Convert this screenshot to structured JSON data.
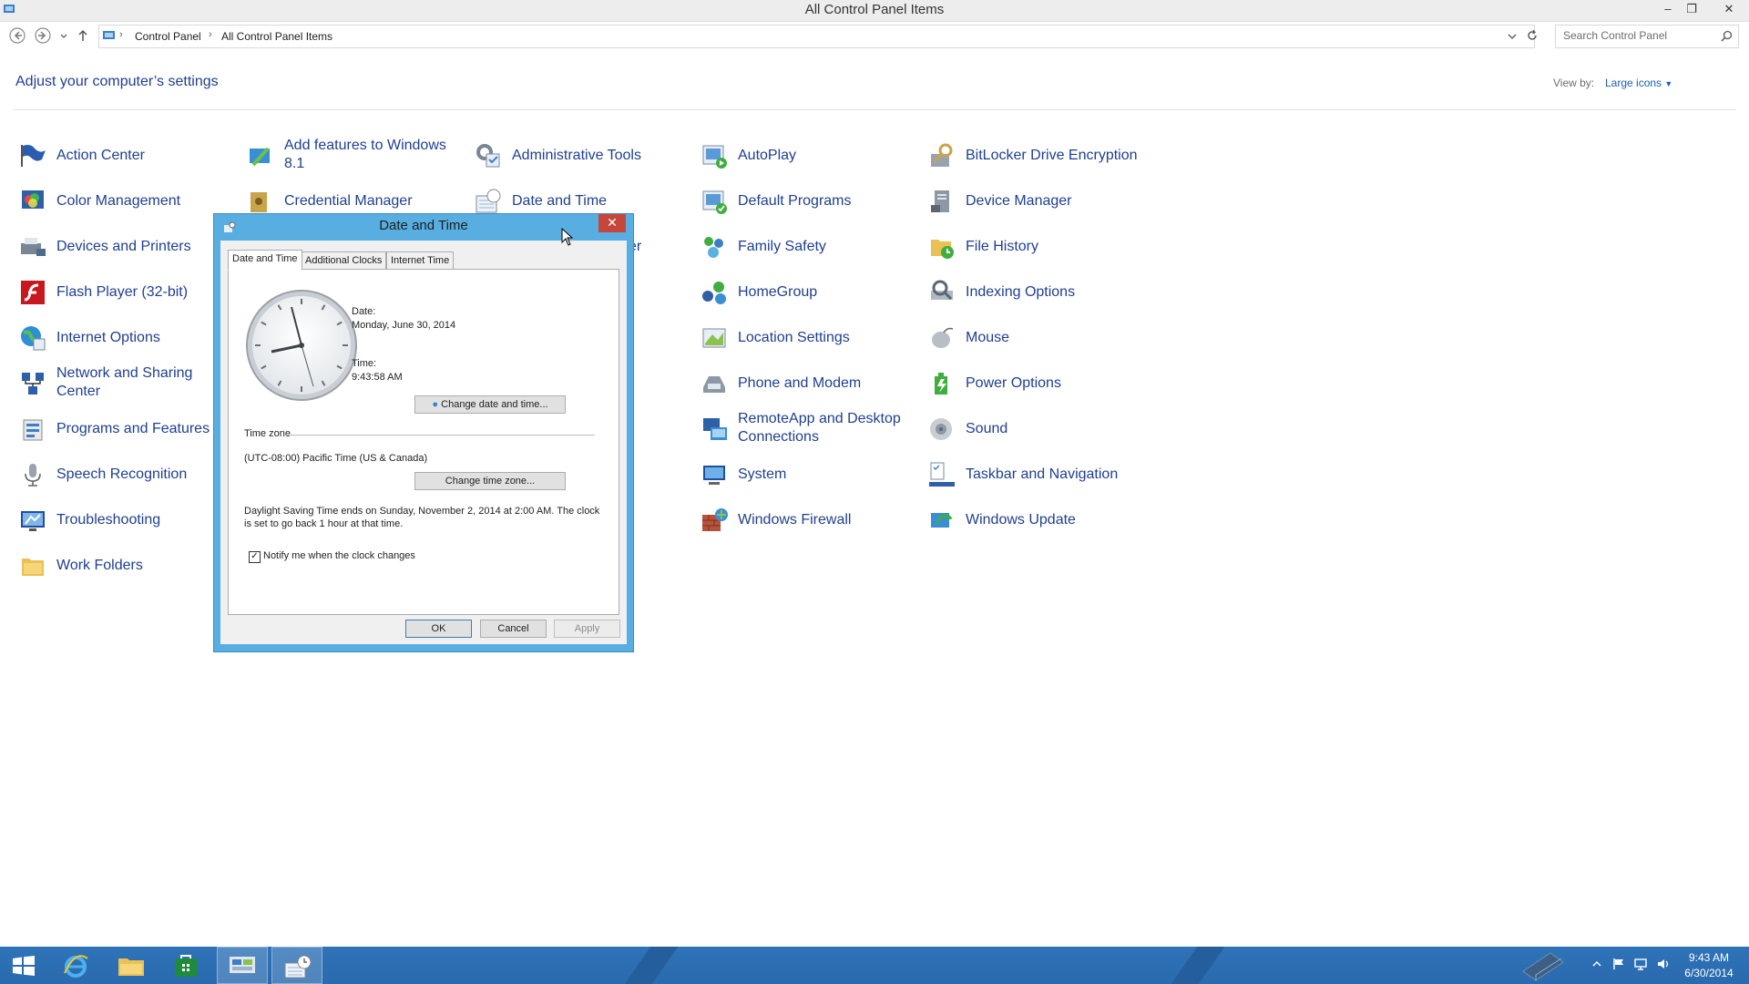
{
  "window": {
    "title": "All Control Panel Items",
    "minimize": "–",
    "restore": "❐",
    "close": "✕"
  },
  "address": {
    "crumbs": [
      "Control Panel",
      "All Control Panel Items"
    ],
    "search_placeholder": "Search Control Panel"
  },
  "header": {
    "title": "Adjust your computer’s settings",
    "view_by_label": "View by:",
    "view_by_value": "Large icons"
  },
  "items": {
    "col1": [
      "Action Center",
      "Color Management",
      "Devices and Printers",
      "Flash Player (32-bit)",
      "Internet Options",
      "Network and Sharing Center",
      "Programs and Features",
      "Speech Recognition",
      "Troubleshooting",
      "Work Folders"
    ],
    "col2": [
      "Add features to Windows 8.1",
      "Credential Manager"
    ],
    "col3": [
      "Administrative Tools",
      "Date and Time",
      "er"
    ],
    "col4": [
      "AutoPlay",
      "Default Programs",
      "Family Safety",
      "HomeGroup",
      "Location Settings",
      "Phone and Modem",
      "RemoteApp and Desktop Connections",
      "System",
      "Windows Firewall"
    ],
    "col5": [
      "BitLocker Drive Encryption",
      "Device Manager",
      "File History",
      "Indexing Options",
      "Mouse",
      "Power Options",
      "Sound",
      "Taskbar and Navigation",
      "Windows Update"
    ]
  },
  "dialog": {
    "title": "Date and Time",
    "close": "✕",
    "tabs": [
      "Date and Time",
      "Additional Clocks",
      "Internet Time"
    ],
    "date_label": "Date:",
    "date_value": "Monday, June 30, 2014",
    "time_label": "Time:",
    "time_value": "9:43:58 AM",
    "change_datetime": "Change date and time...",
    "tz_label": "Time zone",
    "tz_value": "(UTC-08:00) Pacific Time (US & Canada)",
    "change_tz": "Change time zone...",
    "dst_text": "Daylight Saving Time ends on Sunday, November 2, 2014 at 2:00 AM. The clock is set to go back 1 hour at that time.",
    "notify_label": "Notify me when the clock changes",
    "notify_check": "✓",
    "ok": "OK",
    "cancel": "Cancel",
    "apply": "Apply"
  },
  "taskbar": {
    "clock_time": "9:43 AM",
    "clock_date": "6/30/2014"
  },
  "colors": {
    "link": "#1f3f8f",
    "accent": "#58aee0",
    "taskbar": "#2f73b8",
    "close_red": "#c7463a"
  }
}
